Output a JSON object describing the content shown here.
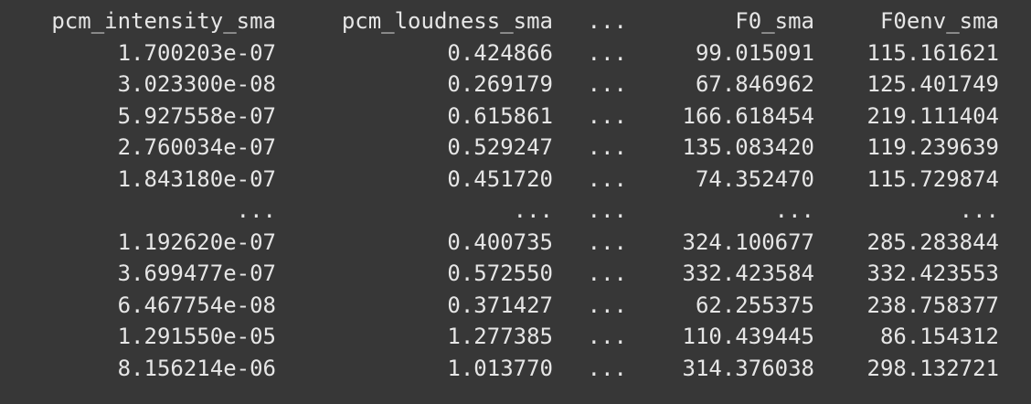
{
  "headers": [
    "pcm_intensity_sma",
    "pcm_loudness_sma",
    "...",
    "F0_sma",
    "F0env_sma"
  ],
  "rows": [
    [
      "1.700203e-07",
      "0.424866",
      "...",
      "99.015091",
      "115.161621"
    ],
    [
      "3.023300e-08",
      "0.269179",
      "...",
      "67.846962",
      "125.401749"
    ],
    [
      "5.927558e-07",
      "0.615861",
      "...",
      "166.618454",
      "219.111404"
    ],
    [
      "2.760034e-07",
      "0.529247",
      "...",
      "135.083420",
      "119.239639"
    ],
    [
      "1.843180e-07",
      "0.451720",
      "...",
      "74.352470",
      "115.729874"
    ],
    [
      "...",
      "...",
      "...",
      "...",
      "..."
    ],
    [
      "1.192620e-07",
      "0.400735",
      "...",
      "324.100677",
      "285.283844"
    ],
    [
      "3.699477e-07",
      "0.572550",
      "...",
      "332.423584",
      "332.423553"
    ],
    [
      "6.467754e-08",
      "0.371427",
      "...",
      "62.255375",
      "238.758377"
    ],
    [
      "1.291550e-05",
      "1.277385",
      "...",
      "110.439445",
      "86.154312"
    ],
    [
      "8.156214e-06",
      "1.013770",
      "...",
      "314.376038",
      "298.132721"
    ]
  ],
  "colors": {
    "background": "#373737",
    "text": "#e6e6e6"
  }
}
